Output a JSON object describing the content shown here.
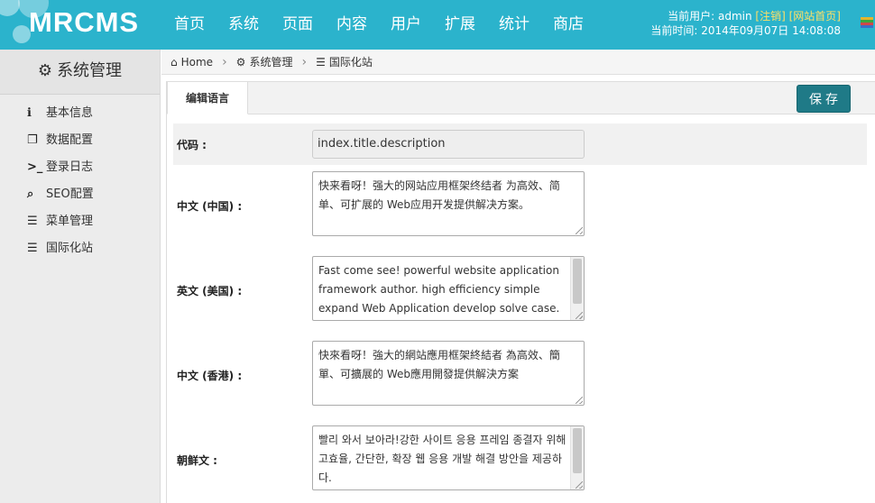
{
  "header": {
    "logo": "MRCMS",
    "nav": [
      "首页",
      "系统",
      "页面",
      "内容",
      "用户",
      "扩展",
      "统计",
      "商店"
    ],
    "user_prefix": "当前用户: admin",
    "logout": "[注销]",
    "site_home": "[网站首页]",
    "time": "当前时间: 2014年09月07日 14:08:08",
    "theme_colors": [
      "#e4b52b",
      "#3da63d",
      "#d04848",
      "#3a6fc4"
    ]
  },
  "sidebar": {
    "title": "系统管理",
    "items": [
      {
        "label": "基本信息",
        "icon": "info-circle-icon",
        "glyph": "ℹ"
      },
      {
        "label": "数据配置",
        "icon": "copy-icon",
        "glyph": "❐"
      },
      {
        "label": "登录日志",
        "icon": "terminal-icon",
        "glyph": ">_"
      },
      {
        "label": "SEO配置",
        "icon": "search-icon",
        "glyph": "⌕"
      },
      {
        "label": "菜单管理",
        "icon": "list-icon",
        "glyph": "☰"
      },
      {
        "label": "国际化站",
        "icon": "list-icon",
        "glyph": "☰"
      }
    ]
  },
  "breadcrumb": {
    "home": "Home",
    "level1": "系统管理",
    "level2": "国际化站"
  },
  "tabs": {
    "active": "编辑语言",
    "save": "保存"
  },
  "form": {
    "code_label": "代码 :",
    "code_value": "index.title.description",
    "zh_cn_label": "中文 (中国) :",
    "zh_cn_value": "快来看呀！强大的网站应用框架终结者 为高效、简单、可扩展的 Web应用开发提供解决方案。",
    "en_us_label": "英文 (美国) :",
    "en_us_value": "Fast come see! powerful website application framework author. high efficiency simple expand Web Application develop solve case.",
    "zh_hk_label": "中文 (香港) :",
    "zh_hk_value": "快來看呀！強大的網站應用框架終結者 為高效、簡單、可擴展的 Web應用開發提供解決方案",
    "ko_label": "朝鲜文 :",
    "ko_value": "빨리 와서 보아라!강한 사이트 응용 프레임 종결자 위해 고효율, 간단한, 확장 웹 응용 개발 해결 방안을 제공하다."
  }
}
